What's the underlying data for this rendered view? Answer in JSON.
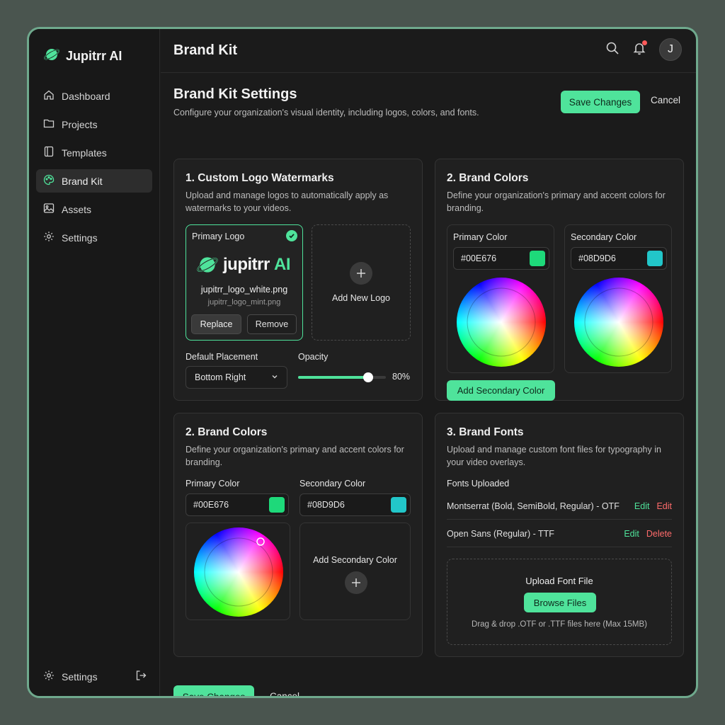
{
  "app": {
    "brand": "Jupitrr AI",
    "header_title": "Brand Kit",
    "avatar_initial": "J"
  },
  "sidebar": {
    "items": [
      {
        "label": "Dashboard",
        "icon": "home-icon"
      },
      {
        "label": "Projects",
        "icon": "folder-icon"
      },
      {
        "label": "Templates",
        "icon": "template-icon"
      },
      {
        "label": "Brand Kit",
        "icon": "palette-icon",
        "active": true
      },
      {
        "label": "Assets",
        "icon": "image-icon"
      },
      {
        "label": "Settings",
        "icon": "gear-icon"
      }
    ],
    "bottom_label": "Settings"
  },
  "page": {
    "title": "Brand Kit Settings",
    "subtitle": "Configure your organization's visual identity, including logos, colors, and fonts.",
    "save_label": "Save Changes",
    "cancel_label": "Cancel"
  },
  "logos": {
    "title": "1. Custom Logo Watermarks",
    "desc": "Upload and manage logos to automatically apply as watermarks to your videos.",
    "primary_label": "Primary Logo",
    "logo_text_a": "jupitrr ",
    "logo_text_b": "AI",
    "file_main": "jupitrr_logo_white.png",
    "file_alt": "jupitrr_logo_mint.png",
    "replace_label": "Replace",
    "remove_label": "Remove",
    "add_new_label": "Add New Logo",
    "placement_label": "Default Placement",
    "placement_value": "Bottom Right",
    "opacity_label": "Opacity",
    "opacity_value": "80%",
    "opacity_fraction": 0.8
  },
  "colors_top": {
    "title": "2. Brand Colors",
    "desc": "Define your organization's primary and accent colors for branding.",
    "primary_label": "Primary Color",
    "primary_hex": "#00E676",
    "primary_swatch": "#1ed97a",
    "secondary_label": "Secondary Color",
    "secondary_hex": "#08D9D6",
    "secondary_swatch": "#22c6c9",
    "add_secondary_label": "Add Secondary Color"
  },
  "colors_bottom": {
    "title": "2. Brand Colors",
    "desc": "Define your organization's primary and accent colors for branding.",
    "primary_label": "Primary Color",
    "primary_hex": "#00E676",
    "secondary_label": "Secondary Color",
    "secondary_hex": "#08D9D6",
    "add_secondary_label": "Add Secondary Color"
  },
  "fonts": {
    "title": "3. Brand Fonts",
    "desc": "Upload and manage custom font files for typography in your video overlays.",
    "uploaded_label": "Fonts Uploaded",
    "rows": [
      {
        "name": "Montserrat (Bold, SemiBold, Regular) - OTF",
        "action1": "Edit",
        "action2": "Edit"
      },
      {
        "name": "Open Sans (Regular) - TTF",
        "action1": "Edit",
        "action2": "Delete"
      }
    ],
    "upload_title": "Upload Font File",
    "browse_label": "Browse Files",
    "upload_hint": "Drag & drop .OTF or .TTF files here (Max 15MB)"
  },
  "footer": {
    "save_label": "Save Changes",
    "cancel_label": "Cancel"
  }
}
